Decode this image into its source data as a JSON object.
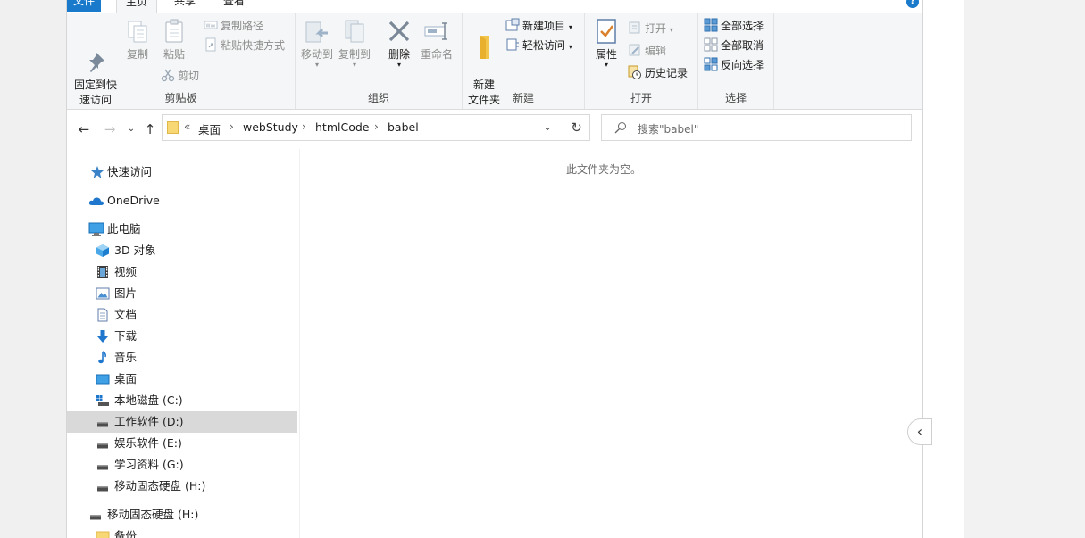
{
  "tabs": {
    "file": "文件",
    "home": "主页",
    "share": "共享",
    "view": "查看"
  },
  "ribbon": {
    "clipboard": {
      "label": "剪贴板",
      "pin": "固定到快\n速访问",
      "copy": "复制",
      "paste": "粘贴",
      "copy_path": "复制路径",
      "paste_shortcut": "粘贴快捷方式",
      "cut": "剪切"
    },
    "organize": {
      "label": "组织",
      "move_to": "移动到",
      "copy_to": "复制到",
      "delete": "删除",
      "rename": "重命名"
    },
    "new": {
      "label": "新建",
      "new_folder": "新建\n文件夹",
      "new_item": "新建项目",
      "easy_access": "轻松访问"
    },
    "open": {
      "label": "打开",
      "properties": "属性",
      "open": "打开",
      "edit": "编辑",
      "history": "历史记录"
    },
    "select": {
      "label": "选择",
      "select_all": "全部选择",
      "select_none": "全部取消",
      "invert": "反向选择"
    }
  },
  "address": {
    "overflow": "«",
    "crumbs": [
      "桌面",
      "webStudy",
      "htmlCode",
      "babel"
    ],
    "search_placeholder": "搜索\"babel\""
  },
  "nav": {
    "quick_access": "快速访问",
    "onedrive": "OneDrive",
    "this_pc": "此电脑",
    "objects_3d": "3D 对象",
    "videos": "视频",
    "pictures": "图片",
    "documents": "文档",
    "downloads": "下载",
    "music": "音乐",
    "desktop": "桌面",
    "drive_c": "本地磁盘 (C:)",
    "drive_d": "工作软件 (D:)",
    "drive_e": "娱乐软件 (E:)",
    "drive_g": "学习资料 (G:)",
    "drive_h": "移动固态硬盘 (H:)",
    "drive_h_root": "移动固态硬盘 (H:)",
    "backup": "备份"
  },
  "content": {
    "empty_message": "此文件夹为空。"
  },
  "colors": {
    "accent": "#1979ca",
    "selected": "#d9d9d9",
    "folder": "#f8d775"
  }
}
